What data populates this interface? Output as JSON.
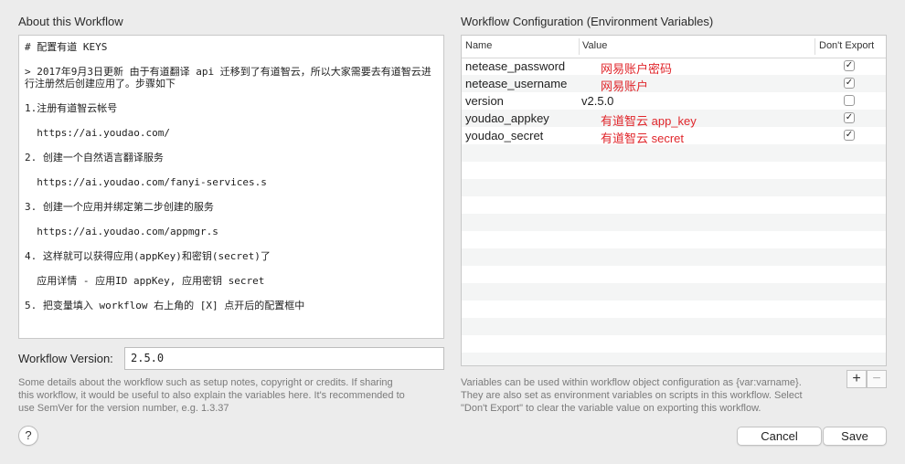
{
  "about": {
    "title": "About this Workflow",
    "notes": [
      "# 配置有道 KEYS",
      "",
      "> 2017年9月3日更新 由于有道翻译 api 迁移到了有道智云，所以大家需要去有道智云进",
      "行注册然后创建应用了。步骤如下",
      "",
      "1.注册有道智云帐号",
      "",
      "  https://ai.youdao.com/",
      "",
      "2. 创建一个自然语言翻译服务",
      "",
      "  https://ai.youdao.com/fanyi-services.s",
      "",
      "3. 创建一个应用并绑定第二步创建的服务",
      "",
      "  https://ai.youdao.com/appmgr.s",
      "",
      "4. 这样就可以获得应用(appKey)和密钥(secret)了",
      "",
      "  应用详情 - 应用ID appKey, 应用密钥 secret",
      "",
      "5. 把变量填入 workflow 右上角的 [X] 点开后的配置框中"
    ],
    "version_label": "Workflow Version:",
    "version_value": "2.5.0",
    "help_text_lines": [
      "Some details about the workflow such as setup notes, copyright or credits. If sharing",
      "this workflow, it would be useful to also explain the variables here. It's recommended to",
      "use SemVer for the version number, e.g. 1.3.37"
    ],
    "help_button": "?"
  },
  "config": {
    "title": "Workflow Configuration (Environment Variables)",
    "columns": [
      "Name",
      "Value",
      "Don't Export"
    ],
    "rows": [
      {
        "name": "netease_password",
        "value": "网易账户密码",
        "dont_export": true,
        "value_color": "#e0262b"
      },
      {
        "name": "netease_username",
        "value": "网易账户",
        "dont_export": true,
        "value_color": "#e0262b"
      },
      {
        "name": "version",
        "value": "v2.5.0",
        "dont_export": false,
        "value_color": "#1f1f1f"
      },
      {
        "name": "youdao_appkey",
        "value": "有道智云 app_key",
        "dont_export": true,
        "value_color": "#e0262b"
      },
      {
        "name": "youdao_secret",
        "value": "有道智云 secret",
        "dont_export": true,
        "value_color": "#e0262b"
      }
    ],
    "add_label": "+",
    "remove_label": "−",
    "help_text_lines": [
      "Variables can be used within workflow object configuration as {var:varname}.",
      "They are also set as environment variables on scripts in this workflow. Select",
      "\"Don't Export\" to clear the variable value on exporting this workflow."
    ]
  },
  "buttons": {
    "cancel": "Cancel",
    "save": "Save"
  },
  "colors": {
    "annotation_red": "#e0262b",
    "background": "#ececec"
  }
}
